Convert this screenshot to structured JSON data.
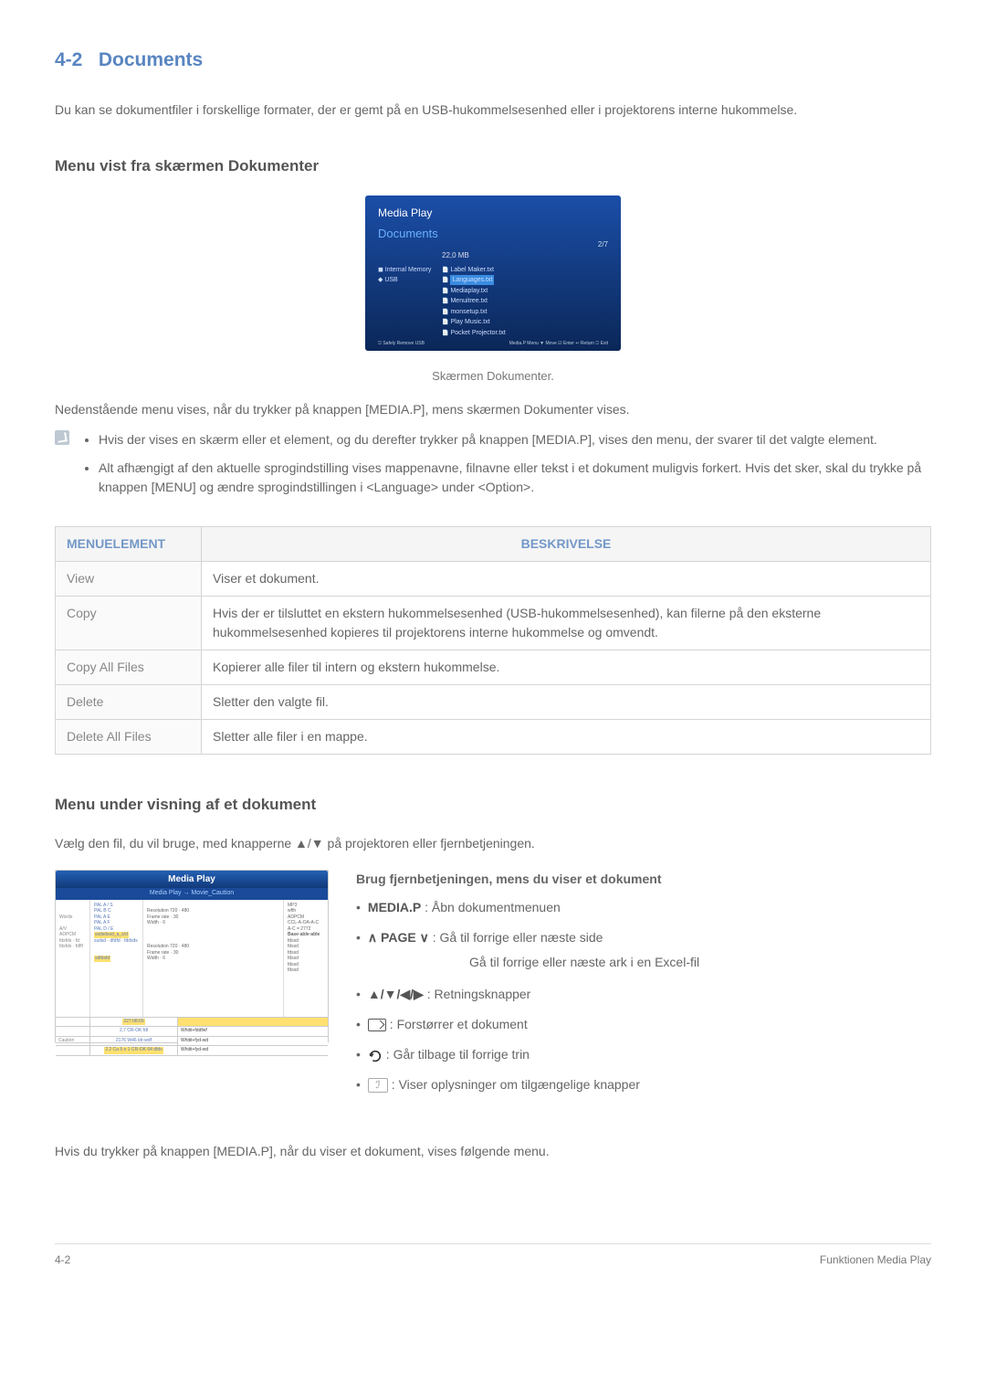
{
  "section": {
    "number": "4-2",
    "title": "Documents"
  },
  "intro": "Du kan se dokumentfiler i forskellige formater, der er gemt på en USB-hukommelsesenhed eller i projektorens interne hukommelse.",
  "sub1": {
    "title": "Menu vist fra skærmen Dokumenter"
  },
  "mediaplay": {
    "title": "Media Play",
    "section": "Documents",
    "size": "22,0 MB",
    "page": "2/7",
    "left": [
      "◼ Internal Memory",
      "◆ USB"
    ],
    "files": [
      "Label Maker.txt",
      "Languages.txt",
      "Mediaplay.txt",
      "Menuitree.txt",
      "monsetup.txt",
      "Play Music.txt",
      "Pocket Projector.txt"
    ],
    "highlighted_index": 1,
    "footer_left": "⎋ Safely Remove USB",
    "footer_right": "Media.P Menu  ▼ Move  ☑ Enter  ↩ Return  ⎋ Exit"
  },
  "caption": "Skærmen Dokumenter.",
  "para1": "Nedenstående menu vises, når du trykker på knappen [MEDIA.P], mens skærmen Dokumenter vises.",
  "bullets": [
    "Hvis der vises en skærm eller et element, og du derefter trykker på knappen [MEDIA.P], vises den menu, der svarer til det valgte element.",
    "Alt afhængigt af den aktuelle sprogindstilling vises mappenavne, filnavne eller tekst i et dokument muligvis forkert. Hvis det sker, skal du trykke på knappen [MENU] og ændre sprogindstillingen i <Language> under <Option>."
  ],
  "table": {
    "head": [
      "MENUELEMENT",
      "BESKRIVELSE"
    ],
    "rows": [
      {
        "k": "View",
        "v": "Viser et dokument."
      },
      {
        "k": "Copy",
        "v": "Hvis der er tilsluttet en ekstern hukommelsesenhed (USB-hukommelsesenhed), kan filerne på den eksterne hukommelsesenhed kopieres til projektorens interne hukommelse og omvendt."
      },
      {
        "k": "Copy All Files",
        "v": "Kopierer alle filer til intern og ekstern hukommelse."
      },
      {
        "k": "Delete",
        "v": "Sletter den valgte fil."
      },
      {
        "k": "Delete All Files",
        "v": "Sletter alle filer i en mappe."
      }
    ]
  },
  "sub2": {
    "title": "Menu under visning af et dokument"
  },
  "sub2_intro": "Vælg den fil, du vil bruge, med knapperne ▲/▼ på projektoren eller fjernbetjeningen.",
  "docview": {
    "title": "Media Play",
    "breadcrumb": "Media Play → Movie_Caution",
    "col1_label": "Words",
    "col2_lines": [
      "PAL A / S",
      "PAL B C",
      "PAL A E",
      "PAL A F",
      "PAL D / E",
      "ssdsdssd_a_s/d",
      "ssdsd · dfdfd · fddsds"
    ],
    "col3_lines": [
      "Resolution 720 · 480",
      "Frame rate · 30",
      "Width · 6",
      "",
      "Resolution 720 · 480",
      "Frame rate · 30",
      "Width · 6"
    ],
    "col4_lines": [
      "MP3",
      "wfth",
      "ADPCM",
      "CCL-A-OA-A-C",
      "A-C = 2772",
      "",
      "Base·able·able",
      "fdssd",
      "fdssd",
      "fdssd",
      "fdssd",
      "fdssd",
      "fdssd"
    ],
    "foot_rows": [
      {
        "c1": "",
        "c2_hl": "227:08:09",
        "c3": "",
        "c4": ""
      },
      {
        "c1": "",
        "c2": "2,7 CR-OK fdl",
        "c3": "Whitit+fddfwf",
        "c4": ""
      },
      {
        "c1": "Caution",
        "c2": "2176 W46   ldr-wdf",
        "c3": "Whitit+fyd-wd",
        "c4": ""
      },
      {
        "c1": "",
        "c2_hl": "2.2 Ca 5 o 1 CR-OK 64 dfds",
        "c3": "Whitit+fyd-wd",
        "c4": ""
      }
    ]
  },
  "remote": {
    "title": "Brug fjernbetjeningen, mens du viser et dokument",
    "items": [
      {
        "label": "MEDIA.P",
        "text": " : Åbn dokumentmenuen"
      },
      {
        "label": "∧ PAGE ∨",
        "sep": " :  ",
        "text": "Gå til forrige eller næste side"
      },
      {
        "sub": "Gå til forrige eller næste ark i en Excel-fil"
      },
      {
        "label": "▲/▼/◀/▶",
        "text": " : Retningsknapper"
      },
      {
        "icon": "zoom",
        "text": " : Forstørrer et dokument"
      },
      {
        "icon": "undo",
        "text": " : Går tilbage til forrige trin"
      },
      {
        "icon": "help",
        "text": " : Viser oplysninger om tilgængelige knapper"
      }
    ]
  },
  "bottom": "Hvis du trykker på knappen [MEDIA.P], når du viser et dokument, vises følgende menu.",
  "footer": {
    "left": "4-2",
    "right": "Funktionen Media Play"
  }
}
